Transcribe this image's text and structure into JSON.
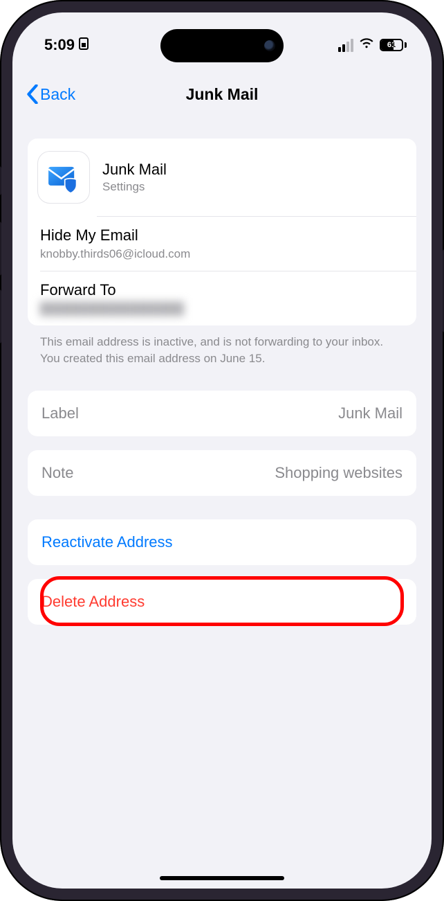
{
  "status": {
    "time": "5:09",
    "battery_percent": "61"
  },
  "nav": {
    "back_label": "Back",
    "title": "Junk Mail"
  },
  "header": {
    "title": "Junk Mail",
    "subtitle": "Settings"
  },
  "hide_my_email": {
    "label": "Hide My Email",
    "address": "knobby.thirds06@icloud.com"
  },
  "forward_to": {
    "label": "Forward To",
    "address_hidden": "████████████████"
  },
  "footer": "This email address is inactive, and is not forwarding to your inbox. You created this email address on June 15.",
  "label_row": {
    "key": "Label",
    "value": "Junk Mail"
  },
  "note_row": {
    "key": "Note",
    "value": "Shopping websites"
  },
  "actions": {
    "reactivate": "Reactivate Address",
    "delete": "Delete Address"
  }
}
